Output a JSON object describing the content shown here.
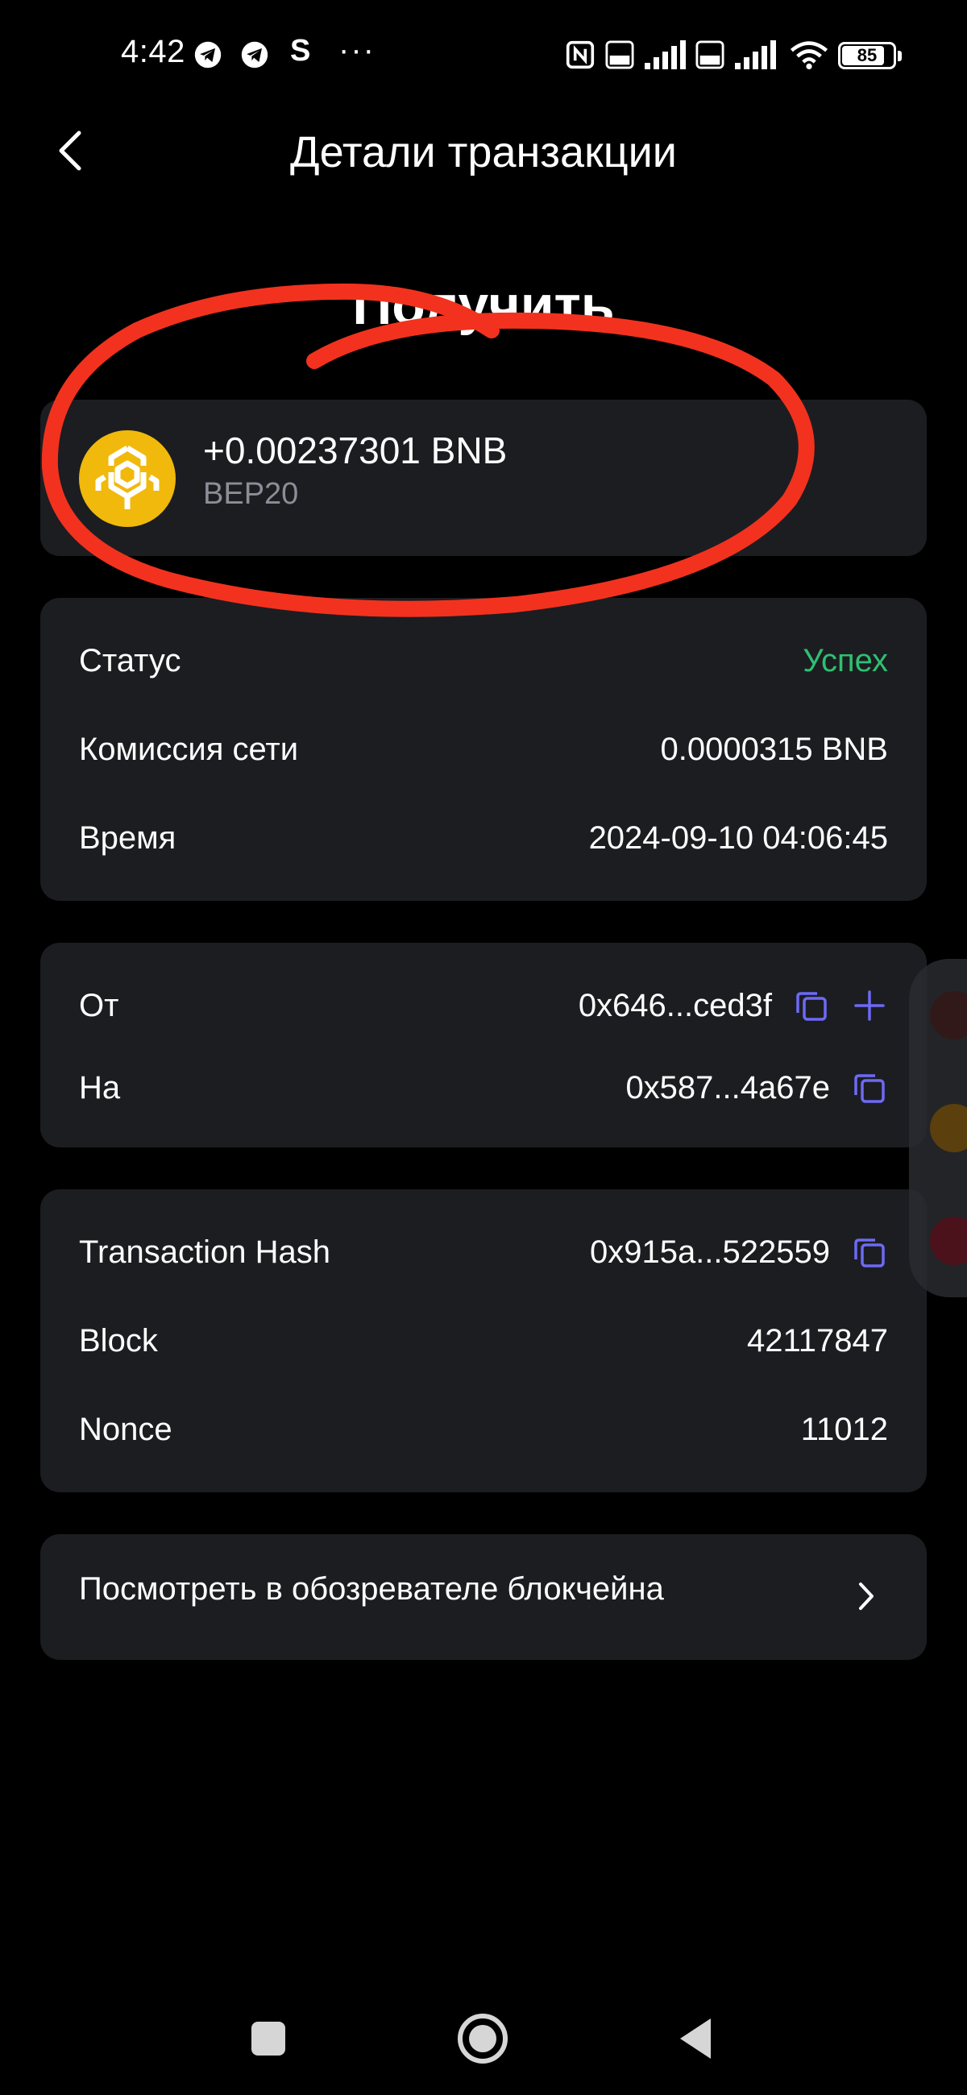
{
  "status_bar": {
    "time": "4:42",
    "notif_s": "S",
    "more_dots": "···",
    "battery_level": "85",
    "battery_fraction": 0.85
  },
  "header": {
    "title": "Детали транзакции"
  },
  "transaction": {
    "type": "Получить",
    "amount": "+0.00237301 BNB",
    "network": "BEP20"
  },
  "details": {
    "status_label": "Статус",
    "status_value": "Успех",
    "fee_label": "Комиссия сети",
    "fee_value": "0.0000315 BNB",
    "time_label": "Время",
    "time_value": "2024-09-10 04:06:45"
  },
  "addresses": {
    "from_label": "От",
    "from_value": "0x646...ced3f",
    "to_label": "На",
    "to_value": "0x587...4a67e"
  },
  "chain": {
    "hash_label": "Transaction Hash",
    "hash_value": "0x915a...522559",
    "block_label": "Block",
    "block_value": "42117847",
    "nonce_label": "Nonce",
    "nonce_value": "11012"
  },
  "explorer": {
    "label": "Посмотреть в обозревателе блокчейна"
  },
  "colors": {
    "background": "#000000",
    "card": "#1c1d21",
    "success": "#2fbf71",
    "accent_icon": "#6d6af5",
    "bnb": "#f0b90b",
    "annotation": "#f2321e",
    "muted": "#8b8d98"
  },
  "icons": {
    "back": "chevron-left-icon",
    "coin": "bnb-logo-icon",
    "copy": "copy-icon",
    "add": "plus-icon",
    "explorer": "chevron-right-icon"
  }
}
